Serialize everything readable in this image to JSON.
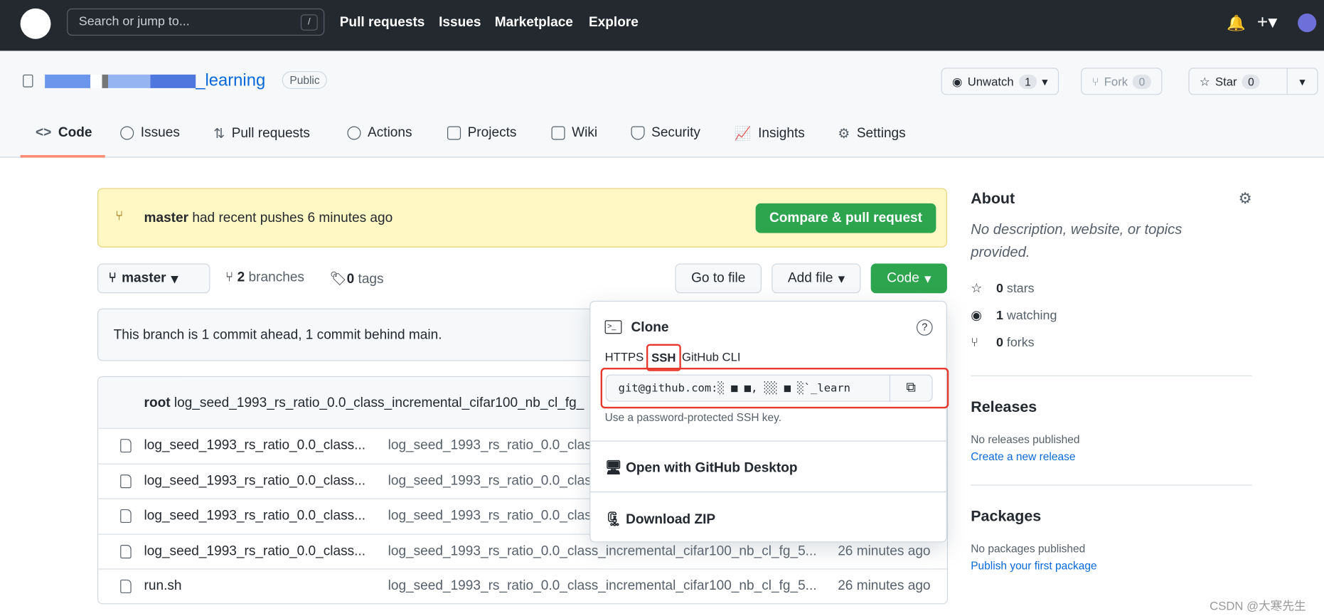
{
  "header": {
    "search_placeholder": "Search or jump to...",
    "search_key": "/",
    "nav": [
      "Pull requests",
      "Issues",
      "Marketplace",
      "Explore"
    ]
  },
  "repo": {
    "name": "_learning",
    "visibility": "Public",
    "unwatch": "Unwatch",
    "watch_count": "1",
    "fork": "Fork",
    "fork_count": "0",
    "star": "Star",
    "star_count": "0"
  },
  "tabs": [
    "Code",
    "Issues",
    "Pull requests",
    "Actions",
    "Projects",
    "Wiki",
    "Security",
    "Insights",
    "Settings"
  ],
  "banner": {
    "branch": "master",
    "text": "had recent pushes 6 minutes ago",
    "button": "Compare & pull request"
  },
  "toolbar": {
    "branch": "master",
    "branches_count": "2",
    "branches_label": "branches",
    "tags_count": "0",
    "tags_label": "tags",
    "go_to_file": "Go to file",
    "add_file": "Add file",
    "code": "Code"
  },
  "ahead_behind": "This branch is 1 commit ahead, 1 commit behind main.",
  "commit": {
    "author": "root",
    "message": "log_seed_1993_rs_ratio_0.0_class_incremental_cifar100_nb_cl_fg_"
  },
  "files": [
    {
      "name": "log_seed_1993_rs_ratio_0.0_class...",
      "message": "log_seed_1993_rs_ratio_0.0_clas",
      "time": ""
    },
    {
      "name": "log_seed_1993_rs_ratio_0.0_class...",
      "message": "log_seed_1993_rs_ratio_0.0_clas",
      "time": ""
    },
    {
      "name": "log_seed_1993_rs_ratio_0.0_class...",
      "message": "log_seed_1993_rs_ratio_0.0_clas",
      "time": ""
    },
    {
      "name": "log_seed_1993_rs_ratio_0.0_class...",
      "message": "log_seed_1993_rs_ratio_0.0_class_incremental_cifar100_nb_cl_fg_5...",
      "time": "26 minutes ago"
    },
    {
      "name": "run.sh",
      "message": "log_seed_1993_rs_ratio_0.0_class_incremental_cifar100_nb_cl_fg_5...",
      "time": "26 minutes ago"
    }
  ],
  "clone": {
    "title": "Clone",
    "tabs": [
      "HTTPS",
      "SSH",
      "GitHub CLI"
    ],
    "active_tab": "SSH",
    "url": "git@github.com:░ ■ ■, ░░ ■ ░`_learn",
    "hint": "Use a password-protected SSH key.",
    "desktop": "Open with GitHub Desktop",
    "zip": "Download ZIP",
    "highlight_color": "#e8382b"
  },
  "about": {
    "title": "About",
    "desc": "No description, website, or topics provided.",
    "stars": "0",
    "stars_label": "stars",
    "watching": "1",
    "watching_label": "watching",
    "forks": "0",
    "forks_label": "forks"
  },
  "releases": {
    "title": "Releases",
    "none": "No releases published",
    "link": "Create a new release"
  },
  "packages": {
    "title": "Packages",
    "none": "No packages published",
    "link": "Publish your first package"
  },
  "watermark": "CSDN @大寒先生"
}
